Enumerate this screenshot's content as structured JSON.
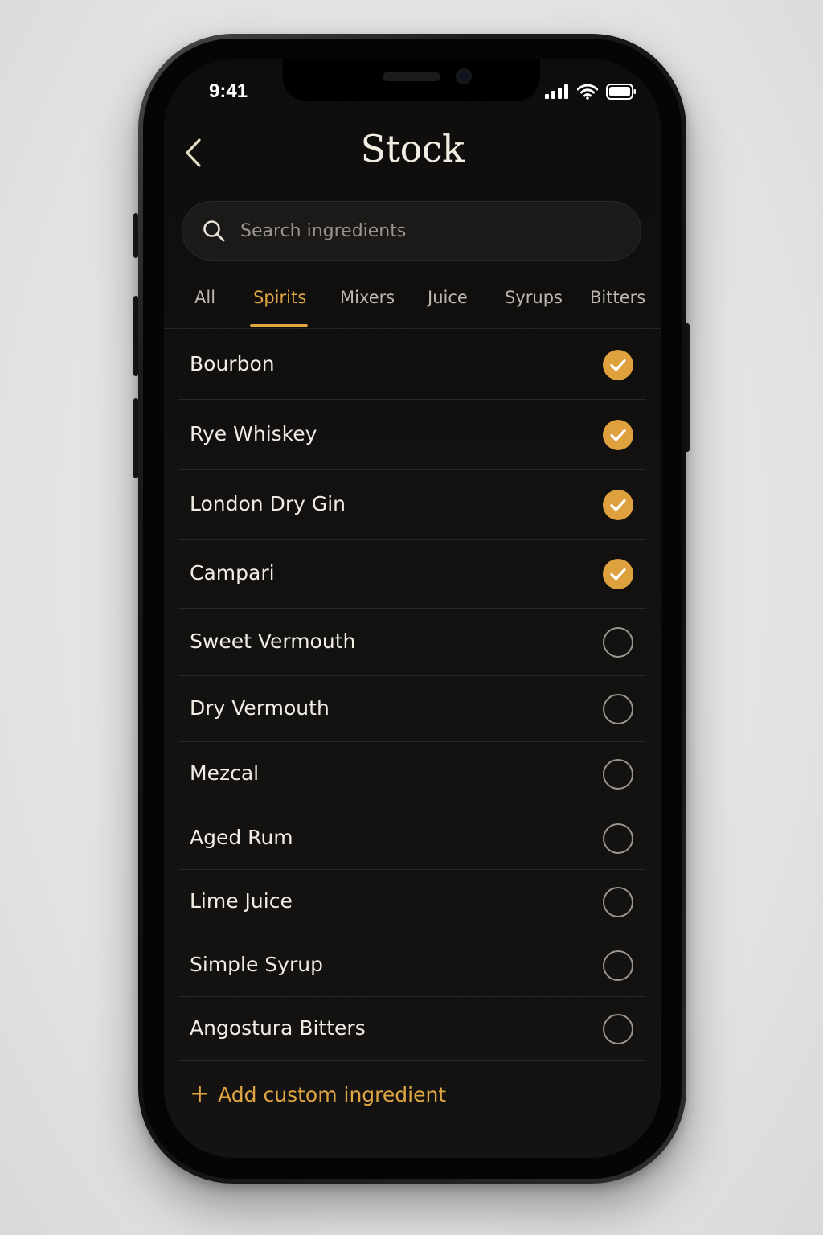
{
  "status_bar": {
    "time": "9:41"
  },
  "header": {
    "title": "Stock"
  },
  "search": {
    "placeholder": "Search ingredients"
  },
  "tabs": [
    {
      "label": "All",
      "active": false
    },
    {
      "label": "Spirits",
      "active": true
    },
    {
      "label": "Mixers",
      "active": false
    },
    {
      "label": "Juice",
      "active": false
    },
    {
      "label": "Syrups",
      "active": false
    },
    {
      "label": "Bitters",
      "active": false
    }
  ],
  "ingredients": [
    {
      "name": "Bourbon",
      "in_stock": true
    },
    {
      "name": "Rye Whiskey",
      "in_stock": true
    },
    {
      "name": "London Dry Gin",
      "in_stock": true
    },
    {
      "name": "Campari",
      "in_stock": true
    },
    {
      "name": "Sweet Vermouth",
      "in_stock": false
    },
    {
      "name": "Dry Vermouth",
      "in_stock": false
    },
    {
      "name": "Mezcal",
      "in_stock": false
    },
    {
      "name": "Aged Rum",
      "in_stock": false
    },
    {
      "name": "Lime Juice",
      "in_stock": false
    },
    {
      "name": "Simple Syrup",
      "in_stock": false
    },
    {
      "name": "Angostura Bitters",
      "in_stock": false
    }
  ],
  "footer": {
    "add_label": "Add custom ingredient",
    "add_icon": "+"
  },
  "colors": {
    "accent": "#e0a642",
    "background": "#121110",
    "text": "#f1ece4",
    "muted": "#bdb7ae"
  },
  "icons": {
    "back": "chevron-left-icon",
    "search": "magnifier-icon",
    "check": "checkmark-icon",
    "signal": "cellular-signal-icon",
    "wifi": "wifi-icon",
    "battery": "battery-icon"
  }
}
